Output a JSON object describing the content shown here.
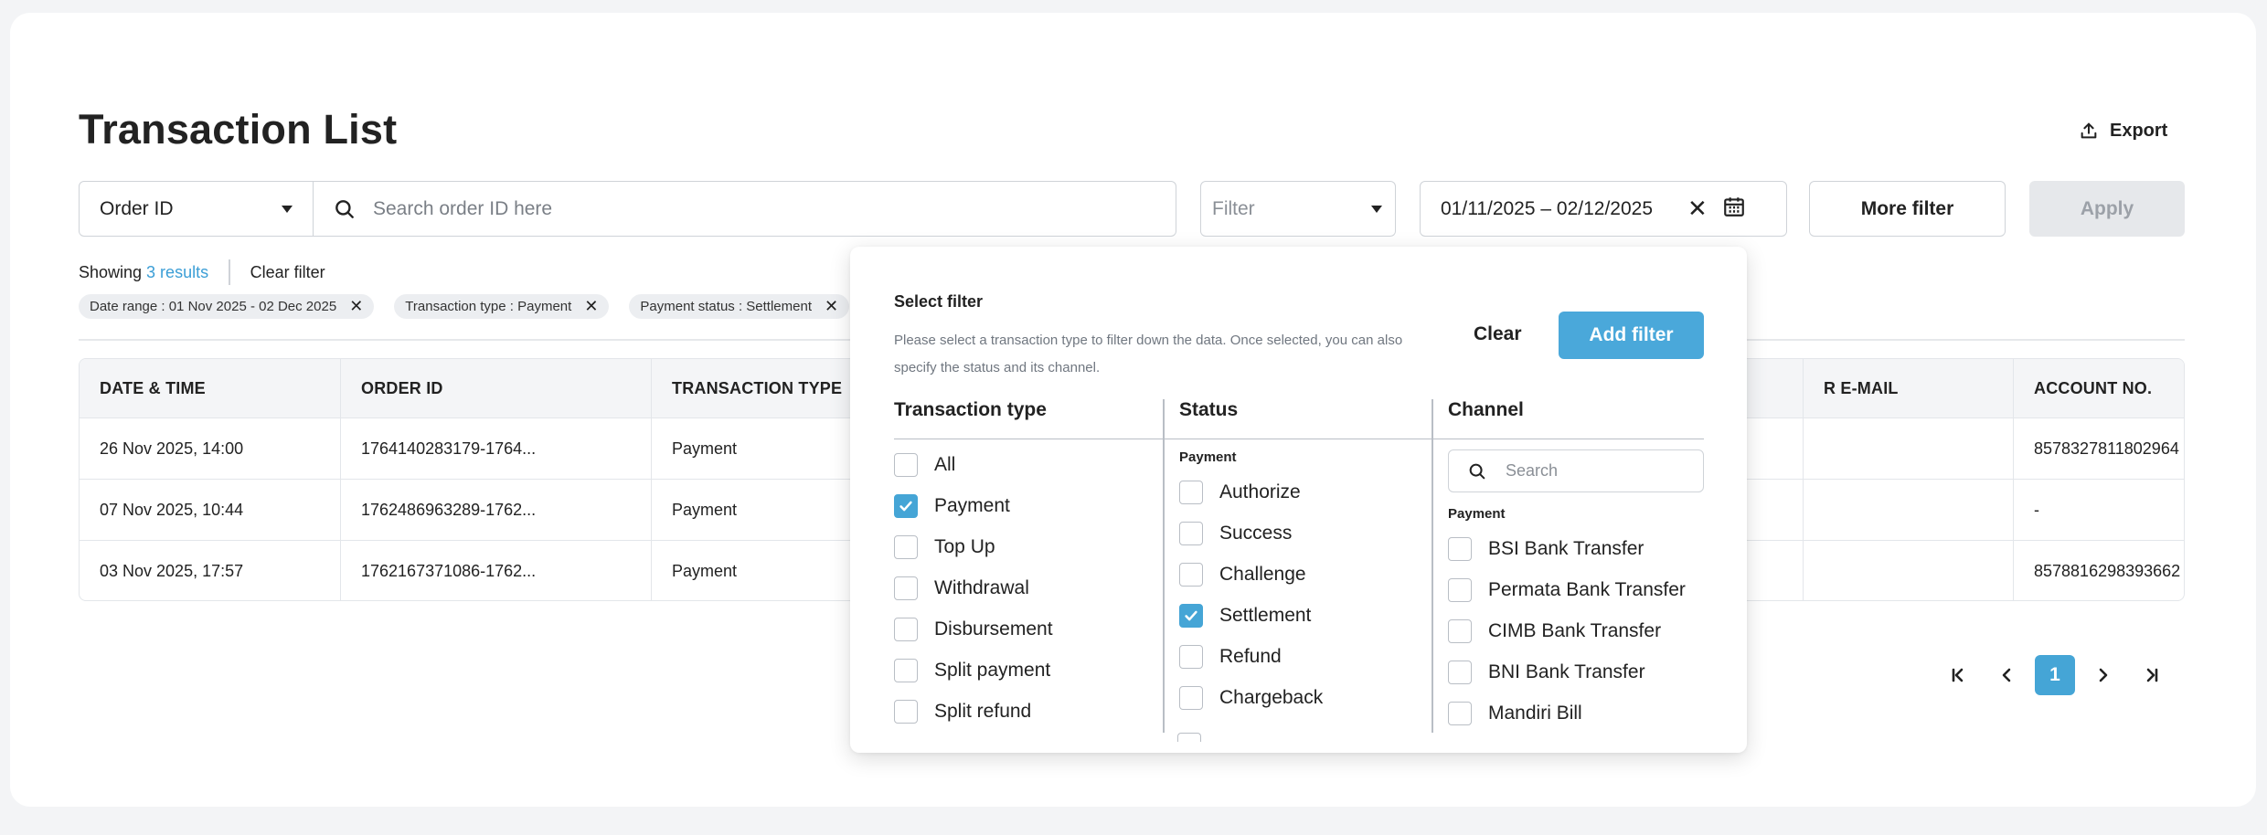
{
  "page": {
    "title": "Transaction List",
    "export_label": "Export"
  },
  "toolbar": {
    "order_select_value": "Order ID",
    "search_placeholder": "Search order ID here",
    "filter_placeholder": "Filter",
    "date_range_value": "01/11/2025 – 02/12/2025",
    "more_filter_label": "More filter",
    "apply_label": "Apply"
  },
  "results": {
    "showing_label": "Showing",
    "count_label": "3 results",
    "clear_filter_label": "Clear filter"
  },
  "chips": [
    {
      "label": "Date range : 01 Nov 2025 - 02 Dec 2025"
    },
    {
      "label": "Transaction type : Payment"
    },
    {
      "label": "Payment status : Settlement"
    }
  ],
  "table": {
    "columns": [
      "DATE & TIME",
      "ORDER ID",
      "TRANSACTION TYPE",
      "",
      "R E-MAIL",
      "ACCOUNT NO."
    ],
    "rows": [
      {
        "date": "26 Nov 2025, 14:00",
        "order_id": "1764140283179-1764...",
        "type": "Payment",
        "account": "8578327811802964"
      },
      {
        "date": "07 Nov 2025, 10:44",
        "order_id": "1762486963289-1762...",
        "type": "Payment",
        "account": "-"
      },
      {
        "date": "03 Nov 2025, 17:57",
        "order_id": "1762167371086-1762...",
        "type": "Payment",
        "account": "8578816298393662"
      }
    ]
  },
  "pagination": {
    "current_page": "1",
    "first_icon": "first-page-icon",
    "prev_icon": "chevron-left-icon",
    "next_icon": "chevron-right-icon",
    "last_icon": "last-page-icon"
  },
  "filter_popup": {
    "title": "Select filter",
    "description": "Please select a transaction type to filter down the data. Once selected, you can also specify the status and its channel.",
    "clear_label": "Clear",
    "add_filter_label": "Add filter",
    "transaction_type": {
      "heading": "Transaction type",
      "options": [
        {
          "label": "All",
          "checked": false
        },
        {
          "label": "Payment",
          "checked": true
        },
        {
          "label": "Top Up",
          "checked": false
        },
        {
          "label": "Withdrawal",
          "checked": false
        },
        {
          "label": "Disbursement",
          "checked": false
        },
        {
          "label": "Split payment",
          "checked": false
        },
        {
          "label": "Split refund",
          "checked": false
        }
      ]
    },
    "status": {
      "heading": "Status",
      "group_label": "Payment",
      "options": [
        {
          "label": "Authorize",
          "checked": false
        },
        {
          "label": "Success",
          "checked": false
        },
        {
          "label": "Challenge",
          "checked": false
        },
        {
          "label": "Settlement",
          "checked": true
        },
        {
          "label": "Refund",
          "checked": false
        },
        {
          "label": "Chargeback",
          "checked": false
        }
      ]
    },
    "channel": {
      "heading": "Channel",
      "search_placeholder": "Search",
      "group_label": "Payment",
      "options": [
        {
          "label": "BSI Bank Transfer",
          "checked": false
        },
        {
          "label": "Permata Bank Transfer",
          "checked": false
        },
        {
          "label": "CIMB Bank Transfer",
          "checked": false
        },
        {
          "label": "BNI Bank Transfer",
          "checked": false
        },
        {
          "label": "Mandiri Bill",
          "checked": false
        }
      ]
    }
  },
  "colors": {
    "accent": "#45a5d6",
    "link": "#3b9ed6",
    "apply_disabled_bg": "#e6e8eb"
  }
}
